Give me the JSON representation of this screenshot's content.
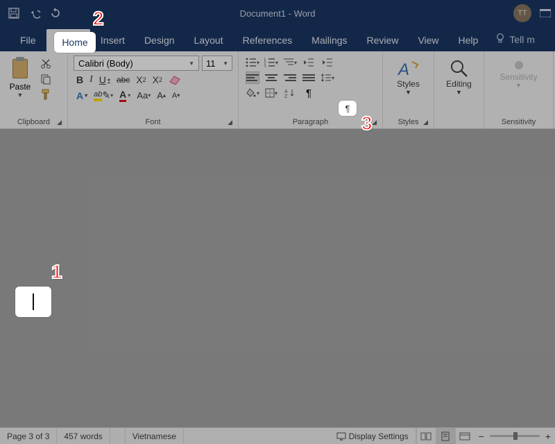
{
  "titlebar": {
    "doc": "Document1",
    "app": "Word",
    "separator": "  -  ",
    "avatar": "TT"
  },
  "menu": {
    "file": "File",
    "home": "Home",
    "insert": "Insert",
    "design": "Design",
    "layout": "Layout",
    "references": "References",
    "mailings": "Mailings",
    "review": "Review",
    "view": "View",
    "help": "Help",
    "tellme": "Tell m"
  },
  "ribbon": {
    "clipboard": {
      "label": "Clipboard",
      "paste": "Paste"
    },
    "font": {
      "label": "Font",
      "name": "Calibri (Body)",
      "size": "11"
    },
    "paragraph": {
      "label": "Paragraph"
    },
    "styles": {
      "label": "Styles",
      "btn": "Styles"
    },
    "editing": {
      "btn": "Editing"
    },
    "sensitivity": {
      "label": "Sensitivity",
      "btn": "Sensitivity"
    }
  },
  "status": {
    "page": "Page 3 of 3",
    "words": "457 words",
    "lang": "Vietnamese",
    "display": "Display Settings"
  },
  "callouts": {
    "one": "1",
    "two": "2",
    "three": "3"
  },
  "pilcrow": "¶"
}
